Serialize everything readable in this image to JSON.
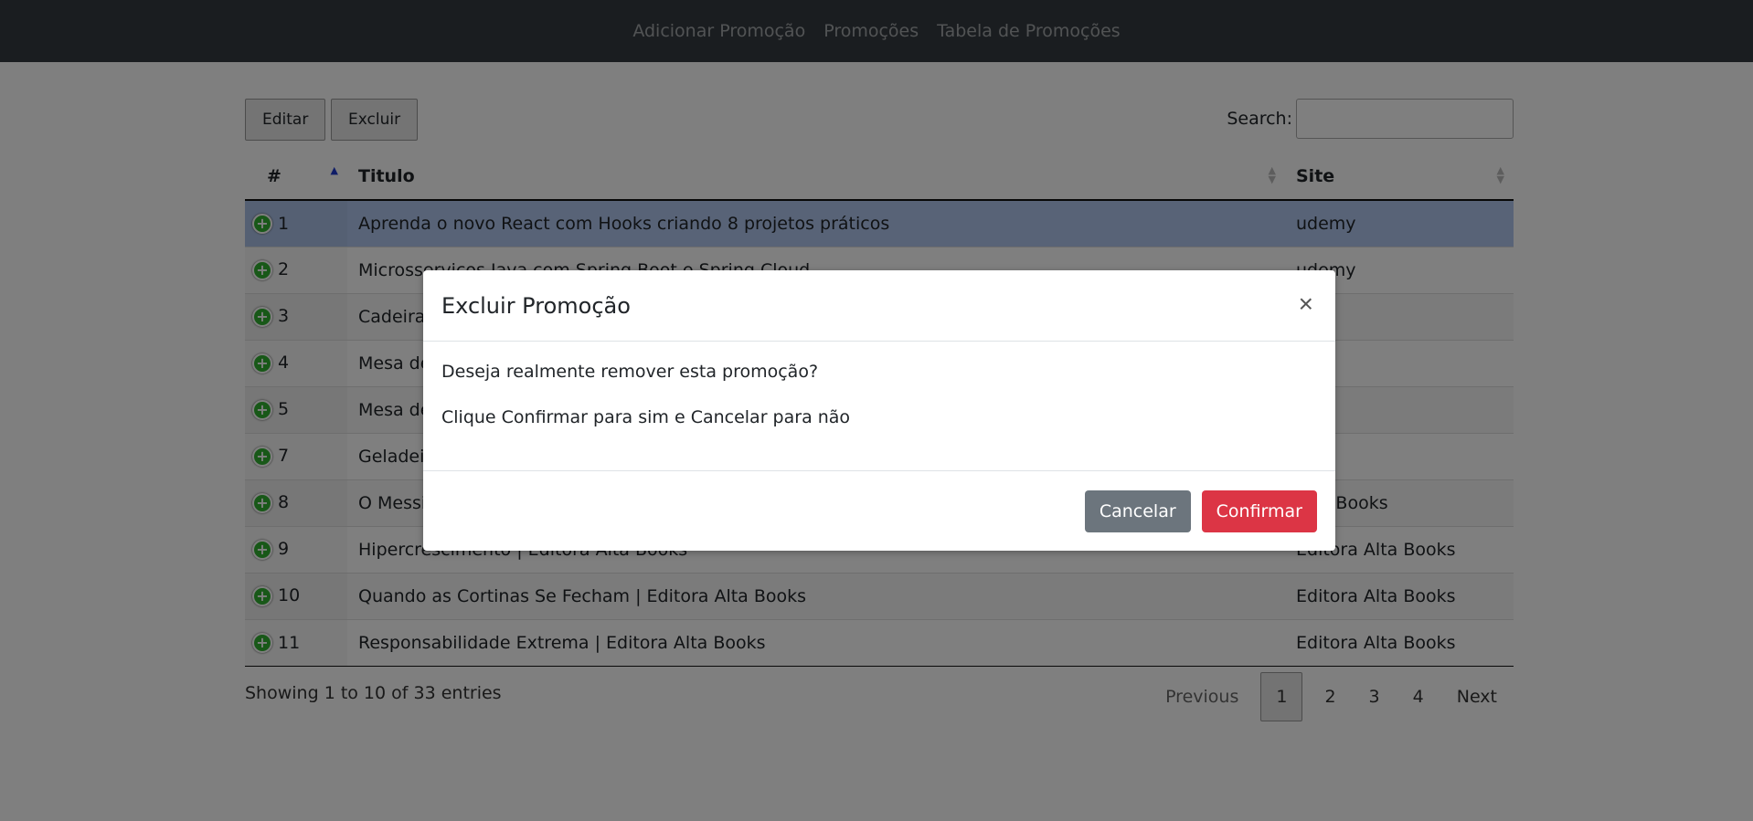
{
  "navbar": {
    "links": [
      "Adicionar Promoção",
      "Promoções",
      "Tabela de Promoções"
    ]
  },
  "toolbar": {
    "edit_label": "Editar",
    "delete_label": "Excluir",
    "search_label": "Search:"
  },
  "table": {
    "headers": [
      "#",
      "Titulo",
      "Site"
    ],
    "rows": [
      {
        "id": "1",
        "title": "Aprenda o novo React com Hooks criando 8 projetos práticos",
        "site": "udemy"
      },
      {
        "id": "2",
        "title": "Microsservicos Java com Spring Boot e Spring Cloud",
        "site": "udemy"
      },
      {
        "id": "3",
        "title": "Cadeira d",
        "site": ""
      },
      {
        "id": "4",
        "title": "Mesa de",
        "site": ""
      },
      {
        "id": "5",
        "title": "Mesa de",
        "site": ""
      },
      {
        "id": "7",
        "title": "Geladeira",
        "site": ""
      },
      {
        "id": "8",
        "title": "O Messia",
        "site": "Alta Books"
      },
      {
        "id": "9",
        "title": "Hipercrescimento | Editora Alta Books",
        "site": "Editora Alta Books"
      },
      {
        "id": "10",
        "title": "Quando as Cortinas Se Fecham | Editora Alta Books",
        "site": "Editora Alta Books"
      },
      {
        "id": "11",
        "title": "Responsabilidade Extrema | Editora Alta Books",
        "site": "Editora Alta Books"
      }
    ]
  },
  "footer": {
    "info": "Showing 1 to 10 of 33 entries",
    "previous": "Previous",
    "pages": [
      "1",
      "2",
      "3",
      "4"
    ],
    "next": "Next"
  },
  "modal": {
    "title": "Excluir Promoção",
    "close": "×",
    "body_line1": "Deseja realmente remover esta promoção?",
    "body_line2": "Clique Confirmar para sim e Cancelar para não",
    "cancel_label": "Cancelar",
    "confirm_label": "Confirmar"
  },
  "colors": {
    "navbar": "#343a40",
    "selected_row": "#b0c7ef",
    "cancel": "#6c757d",
    "confirm": "#dc3545",
    "expand_icon": "#31b131"
  }
}
